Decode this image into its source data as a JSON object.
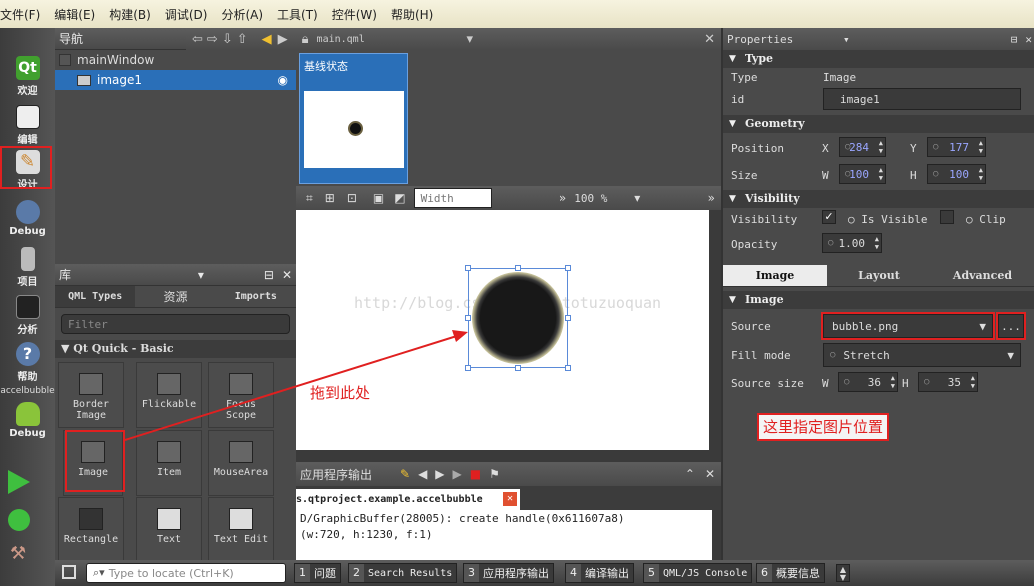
{
  "menu": [
    "文件(F)",
    "编辑(E)",
    "构建(B)",
    "调试(D)",
    "分析(A)",
    "工具(T)",
    "控件(W)",
    "帮助(H)"
  ],
  "modes": {
    "welcome": "欢迎",
    "edit": "编辑",
    "design": "设计",
    "debug": "Debug",
    "project": "项目",
    "analyze": "分析",
    "help": "帮助",
    "target": "accelbubble",
    "target_mode": "Debug"
  },
  "navigator": {
    "title": "导航",
    "items": [
      "mainWindow",
      "image1"
    ]
  },
  "editor": {
    "file": "main.qml",
    "state": "基线状态",
    "width_placeholder": "Width",
    "zoom": "100 %"
  },
  "watermark": "http://blog.csdn.net/tototuzuoquan",
  "annotations": {
    "drag": "拖到此处",
    "source": "这里指定图片位置"
  },
  "library": {
    "title": "库",
    "tabs": [
      "QML Types",
      "资源",
      "Imports"
    ],
    "filter": "Filter",
    "section": "Qt Quick - Basic",
    "items": [
      "Border Image",
      "Flickable",
      "Focus Scope",
      "Image",
      "Item",
      "MouseArea",
      "Rectangle",
      "Text",
      "Text Edit"
    ]
  },
  "output": {
    "title": "应用程序输出",
    "tab": "s.qtproject.example.accelbubble",
    "line1": "D/GraphicBuffer(28005): create handle(0x611607a8)",
    "line2": "(w:720, h:1230, f:1)"
  },
  "properties": {
    "title": "Properties",
    "type": {
      "header": "Type",
      "type_label": "Type",
      "type_value": "Image",
      "id_label": "id",
      "id_value": "image1"
    },
    "geometry": {
      "header": "Geometry",
      "position_label": "Position",
      "size_label": "Size",
      "x_label": "X",
      "y_label": "Y",
      "w_label": "W",
      "h_label": "H",
      "x": "284",
      "y": "177",
      "w": "100",
      "h": "100"
    },
    "visibility": {
      "header": "Visibility",
      "visibility_label": "Visibility",
      "is_visible": "Is Visible",
      "clip": "Clip",
      "opacity_label": "Opacity",
      "opacity": "1.00"
    },
    "tabs": [
      "Image",
      "Layout",
      "Advanced"
    ],
    "image": {
      "header": "Image",
      "source_label": "Source",
      "source": "bubble.png",
      "browse": "...",
      "fill_label": "Fill mode",
      "fill": "Stretch",
      "source_size_label": "Source size",
      "w_label": "W",
      "h_label": "H",
      "w": "36",
      "h": "35"
    }
  },
  "bottom": {
    "locate": "Type to locate (Ctrl+K)",
    "tabs": [
      {
        "n": "1",
        "label": "问题"
      },
      {
        "n": "2",
        "label": "Search Results"
      },
      {
        "n": "3",
        "label": "应用程序输出"
      },
      {
        "n": "4",
        "label": "编译输出"
      },
      {
        "n": "5",
        "label": "QML/JS Console"
      },
      {
        "n": "6",
        "label": "概要信息"
      }
    ]
  },
  "colors": {
    "accent_red": "#e02020",
    "selection": "#2a6fb8",
    "menubar": "#f0ecd2"
  }
}
